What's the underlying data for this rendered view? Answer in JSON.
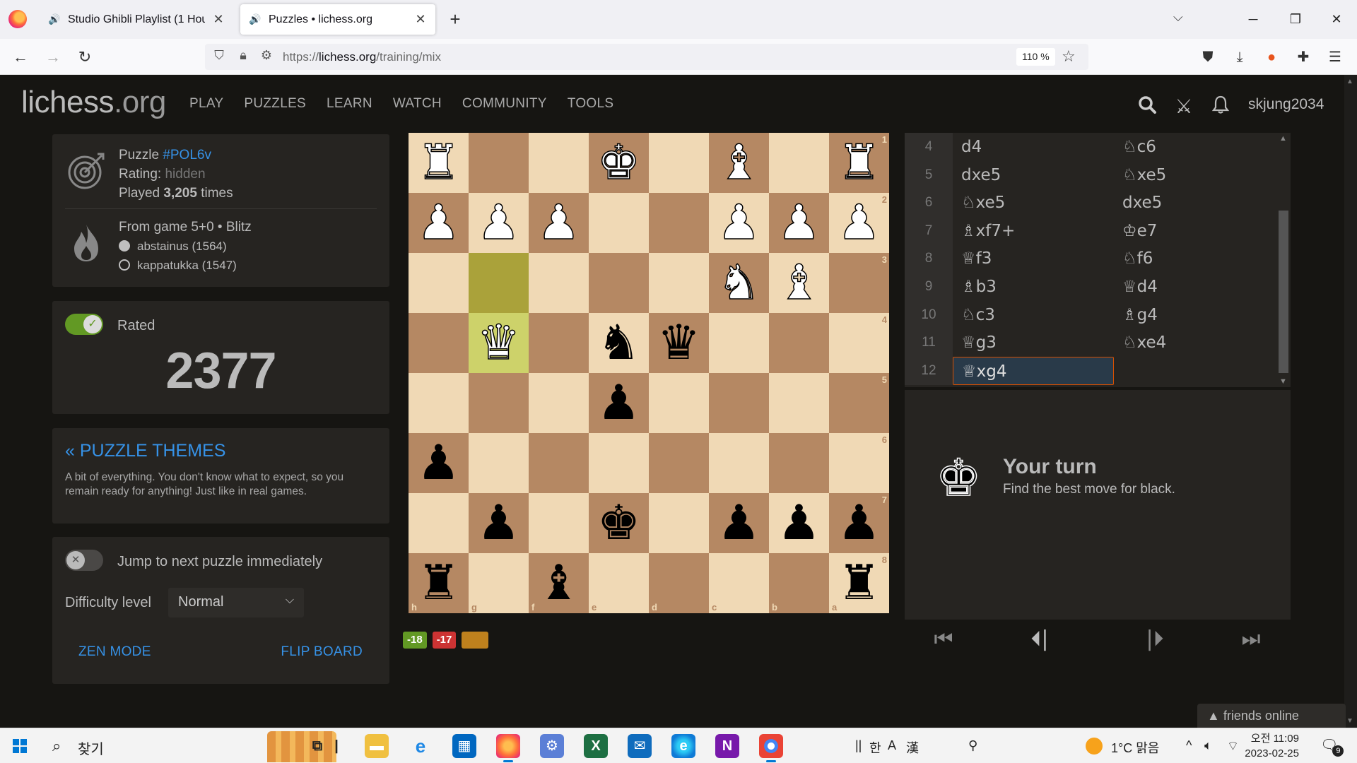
{
  "browser": {
    "tabs": [
      {
        "title": "Studio Ghibli Playlist (1 Hour o",
        "playing": true
      },
      {
        "title": "Puzzles • lichess.org",
        "playing": true
      }
    ],
    "url_scheme": "https://",
    "url_host": "lichess.org",
    "url_path": "/training/mix",
    "zoom": "110 %"
  },
  "site": {
    "logo_main": "lichess",
    "logo_tld": ".org",
    "nav": [
      "PLAY",
      "PUZZLES",
      "LEARN",
      "WATCH",
      "COMMUNITY",
      "TOOLS"
    ],
    "username": "skjung2034"
  },
  "puzzle": {
    "label": "Puzzle ",
    "id": "#POL6v",
    "rating_label": "Rating: ",
    "rating_value": "hidden",
    "played_prefix": "Played ",
    "played_count": "3,205",
    "played_suffix": " times",
    "game": "From game 5+0 • Blitz",
    "white_player": "abstainus (1564)",
    "black_player": "kappatukka (1547)"
  },
  "rated": {
    "label": "Rated",
    "on": true,
    "rating": "2377"
  },
  "themes": {
    "title": "« PUZZLE THEMES",
    "description": "A bit of everything. You don't know what to expect, so you remain ready for anything! Just like in real games."
  },
  "settings": {
    "jump_label": "Jump to next puzzle immediately",
    "jump_on": false,
    "difficulty_label": "Difficulty level",
    "difficulty_value": "Normal",
    "zen_label": "ZEN MODE",
    "flip_label": "FLIP BOARD"
  },
  "board": {
    "orientation": "black",
    "ranks": [
      "1",
      "2",
      "3",
      "4",
      "5",
      "6",
      "7",
      "8"
    ],
    "files": [
      "h",
      "g",
      "f",
      "e",
      "d",
      "c",
      "b",
      "a"
    ],
    "last_move": [
      "g3",
      "g4"
    ],
    "rows": [
      [
        "wR",
        "",
        "",
        "wK",
        "",
        "wB",
        "",
        "wR"
      ],
      [
        "wP",
        "wP",
        "wP",
        "",
        "",
        "wP",
        "wP",
        "wP"
      ],
      [
        "",
        "",
        "",
        "",
        "",
        "wN",
        "wB",
        ""
      ],
      [
        "",
        "wQ",
        "",
        "bN",
        "bQ",
        "",
        "",
        ""
      ],
      [
        "",
        "",
        "",
        "bP",
        "",
        "",
        "",
        ""
      ],
      [
        "bP",
        "",
        "",
        "",
        "",
        "",
        "",
        ""
      ],
      [
        "",
        "bP",
        "",
        "bK",
        "",
        "bP",
        "bP",
        "bP"
      ],
      [
        "bR",
        "",
        "bB",
        "",
        "",
        "",
        "",
        "bR"
      ]
    ]
  },
  "material": {
    "badge1": "-18",
    "badge2": "-17",
    "badge3": ""
  },
  "moves": [
    {
      "n": "4",
      "w": "d4",
      "b": "♘c6"
    },
    {
      "n": "5",
      "w": "dxe5",
      "b": "♘xe5"
    },
    {
      "n": "6",
      "w": "♘xe5",
      "b": "dxe5"
    },
    {
      "n": "7",
      "w": "♗xf7+",
      "b": "♔e7"
    },
    {
      "n": "8",
      "w": "♕f3",
      "b": "♘f6"
    },
    {
      "n": "9",
      "w": "♗b3",
      "b": "♕d4"
    },
    {
      "n": "10",
      "w": "♘c3",
      "b": "♗g4"
    },
    {
      "n": "11",
      "w": "♕g3",
      "b": "♘xe4"
    },
    {
      "n": "12",
      "w": "♕xg4",
      "b": ""
    }
  ],
  "feedback": {
    "title": "Your turn",
    "subtitle": "Find the best move for black."
  },
  "friends": "friends online",
  "taskbar": {
    "search_text": "찾기",
    "lang": "한",
    "weather": "1°C  맑음",
    "time": "오전 11:09",
    "date": "2023-02-25",
    "notif_count": "9"
  }
}
